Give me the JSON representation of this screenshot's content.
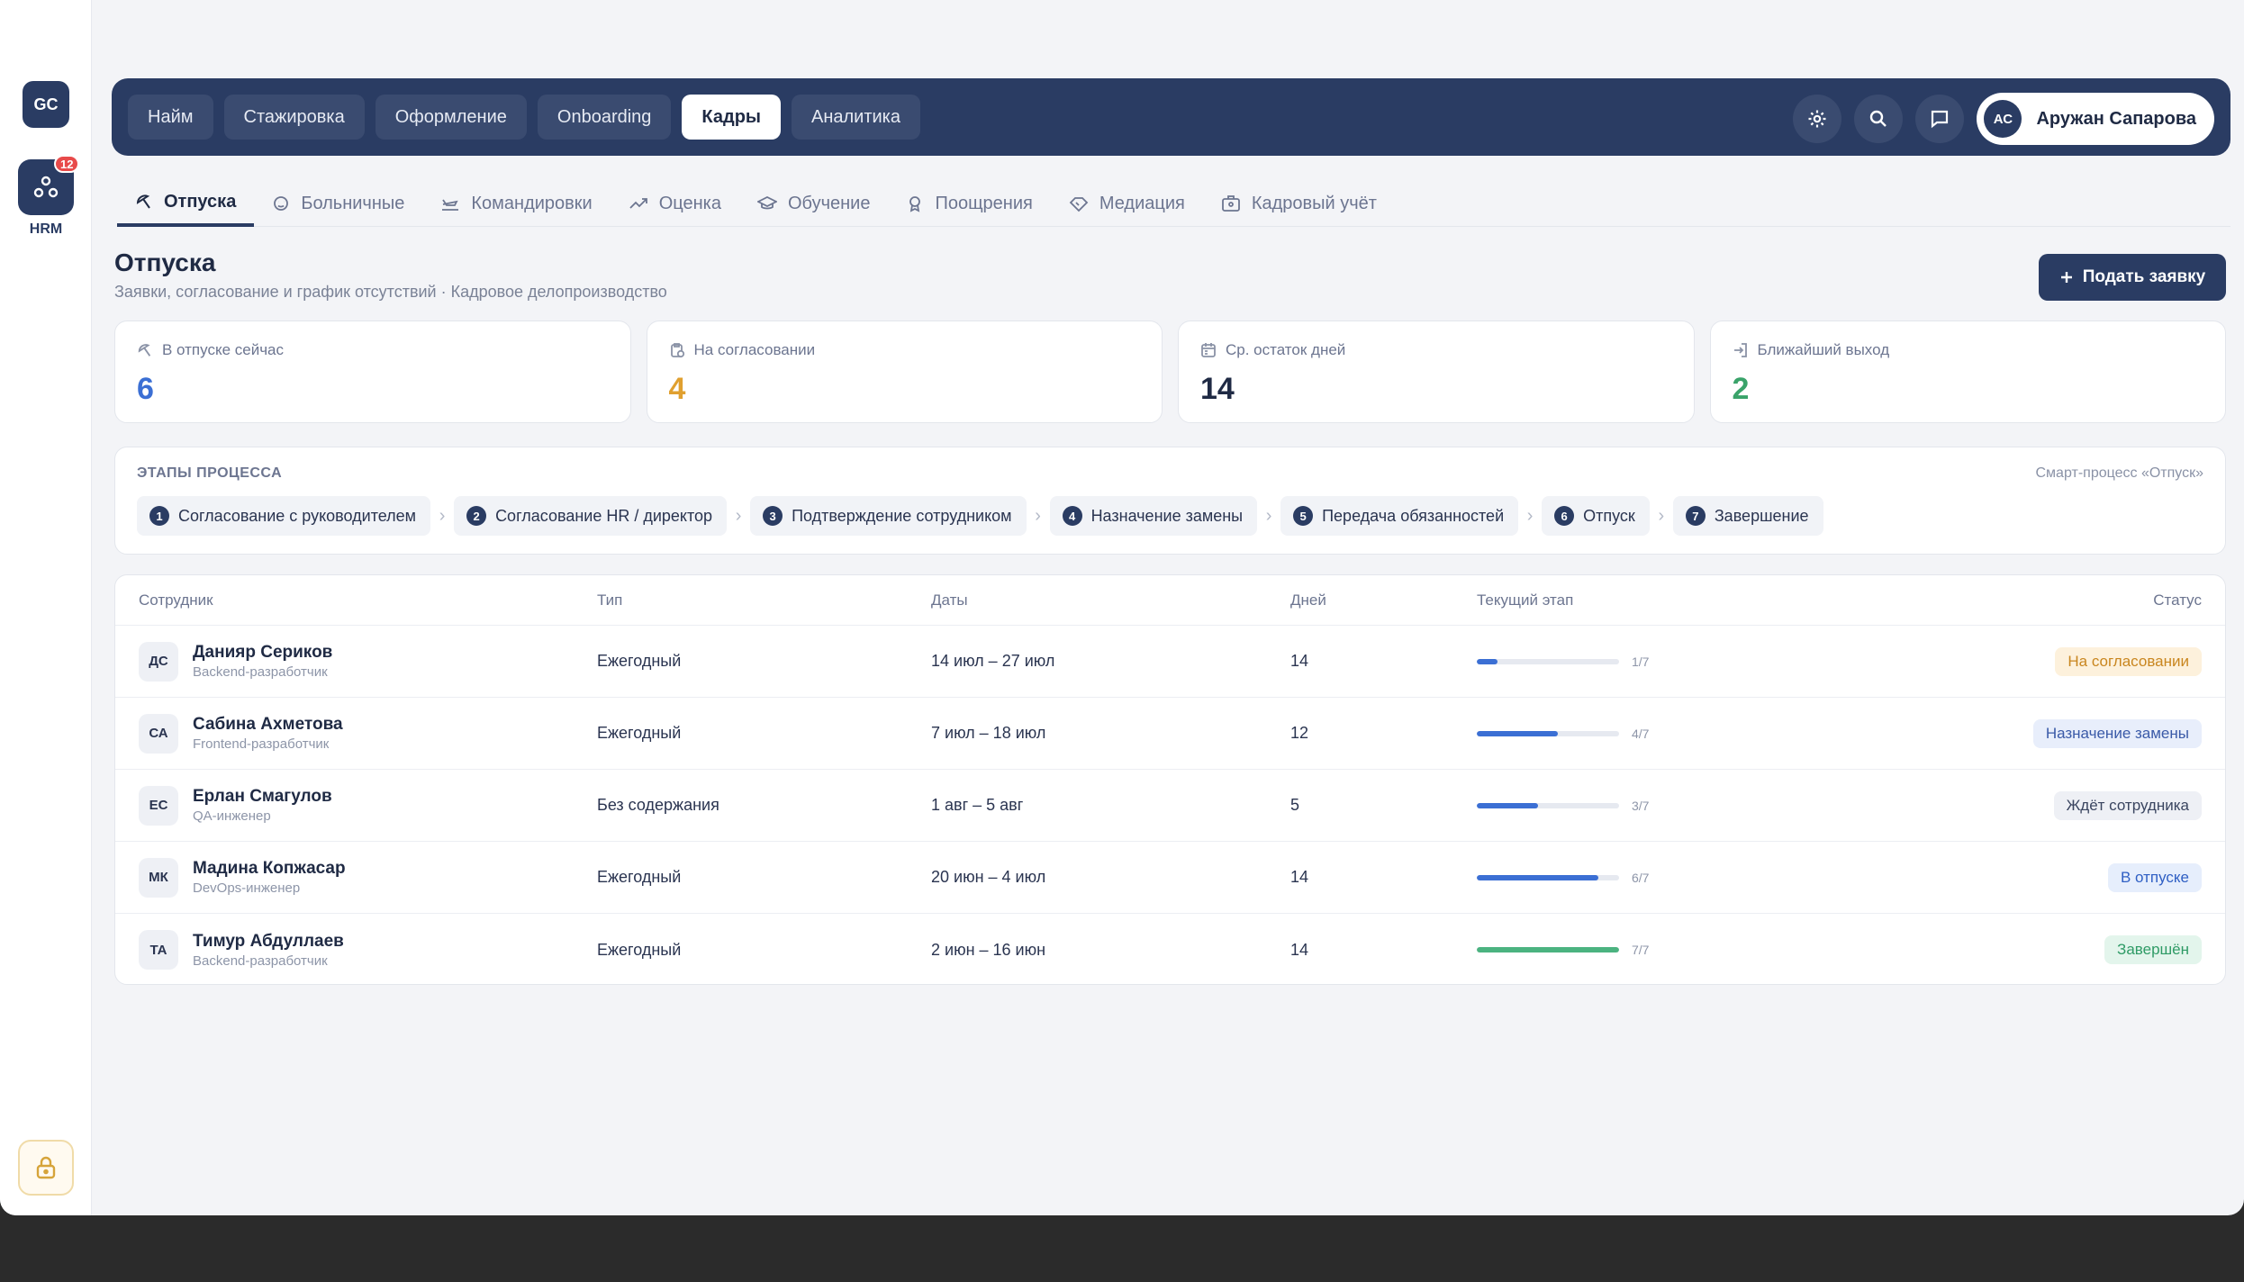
{
  "rail": {
    "logo": "GC",
    "hrm_label": "HRM",
    "hrm_badge": "12"
  },
  "topnav": {
    "tabs": [
      "Найм",
      "Стажировка",
      "Оформление",
      "Onboarding",
      "Кадры",
      "Аналитика"
    ],
    "active": "Кадры",
    "user_initials": "АС",
    "user_name": "Аружан Сапарова"
  },
  "subtabs": [
    {
      "label": "Отпуска",
      "icon": "beach-umbrella-icon",
      "active": true
    },
    {
      "label": "Больничные",
      "icon": "thermometer-icon",
      "active": false
    },
    {
      "label": "Командировки",
      "icon": "plane-icon",
      "active": false
    },
    {
      "label": "Оценка",
      "icon": "trend-icon",
      "active": false
    },
    {
      "label": "Обучение",
      "icon": "graduation-cap-icon",
      "active": false
    },
    {
      "label": "Поощрения",
      "icon": "award-icon",
      "active": false
    },
    {
      "label": "Медиация",
      "icon": "handshake-icon",
      "active": false
    },
    {
      "label": "Кадровый учёт",
      "icon": "id-card-icon",
      "active": false
    }
  ],
  "page": {
    "title": "Отпуска",
    "subtitle": "Заявки, согласование и график отсутствий · Кадровое делопроизводство",
    "cta_label": "Подать заявку"
  },
  "stats": [
    {
      "label": "В отпуске сейчас",
      "value": "6",
      "color": "#3b6fd4",
      "icon": "beach-umbrella-icon"
    },
    {
      "label": "На согласовании",
      "value": "4",
      "color": "#e0a030",
      "icon": "clipboard-clock-icon"
    },
    {
      "label": "Ср. остаток дней",
      "value": "14",
      "color": "#1f2a44",
      "icon": "calendar-icon"
    },
    {
      "label": "Ближайший выход",
      "value": "2",
      "color": "#3aa36a",
      "icon": "sign-in-icon"
    }
  ],
  "process": {
    "title": "ЭТАПЫ ПРОЦЕССА",
    "note": "Смарт-процесс «Отпуск»",
    "steps": [
      {
        "num": "1",
        "label": "Согласование с руководителем"
      },
      {
        "num": "2",
        "label": "Согласование HR / директор"
      },
      {
        "num": "3",
        "label": "Подтверждение сотрудником"
      },
      {
        "num": "4",
        "label": "Назначение замены"
      },
      {
        "num": "5",
        "label": "Передача обязанностей"
      },
      {
        "num": "6",
        "label": "Отпуск"
      },
      {
        "num": "7",
        "label": "Завершение"
      }
    ]
  },
  "table": {
    "headers": {
      "employee": "Сотрудник",
      "type": "Тип",
      "dates": "Даты",
      "days": "Дней",
      "stage": "Текущий этап",
      "status": "Статус"
    },
    "rows": [
      {
        "initials": "ДС",
        "name": "Данияр Сериков",
        "role": "Backend-разработчик",
        "type": "Ежегодный",
        "dates": "14 июл – 27 июл",
        "days": "14",
        "stage_text": "1/7",
        "stage_progress": 0.143,
        "stage_color": "#3b6fd4",
        "status": "На согласовании",
        "status_bg": "#fdf1dc",
        "status_fg": "#c9861f"
      },
      {
        "initials": "СА",
        "name": "Сабина Ахметова",
        "role": "Frontend-разработчик",
        "type": "Ежегодный",
        "dates": "7 июл – 18 июл",
        "days": "12",
        "stage_text": "4/7",
        "stage_progress": 0.571,
        "stage_color": "#3b6fd4",
        "status": "Назначение замены",
        "status_bg": "#e8eefb",
        "status_fg": "#3a5aa8"
      },
      {
        "initials": "ЕС",
        "name": "Ерлан Смагулов",
        "role": "QA-инженер",
        "type": "Без содержания",
        "dates": "1 авг – 5 авг",
        "days": "5",
        "stage_text": "3/7",
        "stage_progress": 0.429,
        "stage_color": "#3b6fd4",
        "status": "Ждёт сотрудника",
        "status_bg": "#eef0f5",
        "status_fg": "#3a4560"
      },
      {
        "initials": "МК",
        "name": "Мадина Копжасар",
        "role": "DevOps-инженер",
        "type": "Ежегодный",
        "dates": "20 июн – 4 июл",
        "days": "14",
        "stage_text": "6/7",
        "stage_progress": 0.857,
        "stage_color": "#3b6fd4",
        "status": "В отпуске",
        "status_bg": "#e6eefc",
        "status_fg": "#2f5fc4"
      },
      {
        "initials": "ТА",
        "name": "Тимур Абдуллаев",
        "role": "Backend-разработчик",
        "type": "Ежегодный",
        "dates": "2 июн – 16 июн",
        "days": "14",
        "stage_text": "7/7",
        "stage_progress": 1.0,
        "stage_color": "#4bb380",
        "status": "Завершён",
        "status_bg": "#e3f5ec",
        "status_fg": "#2f9b66"
      }
    ]
  }
}
